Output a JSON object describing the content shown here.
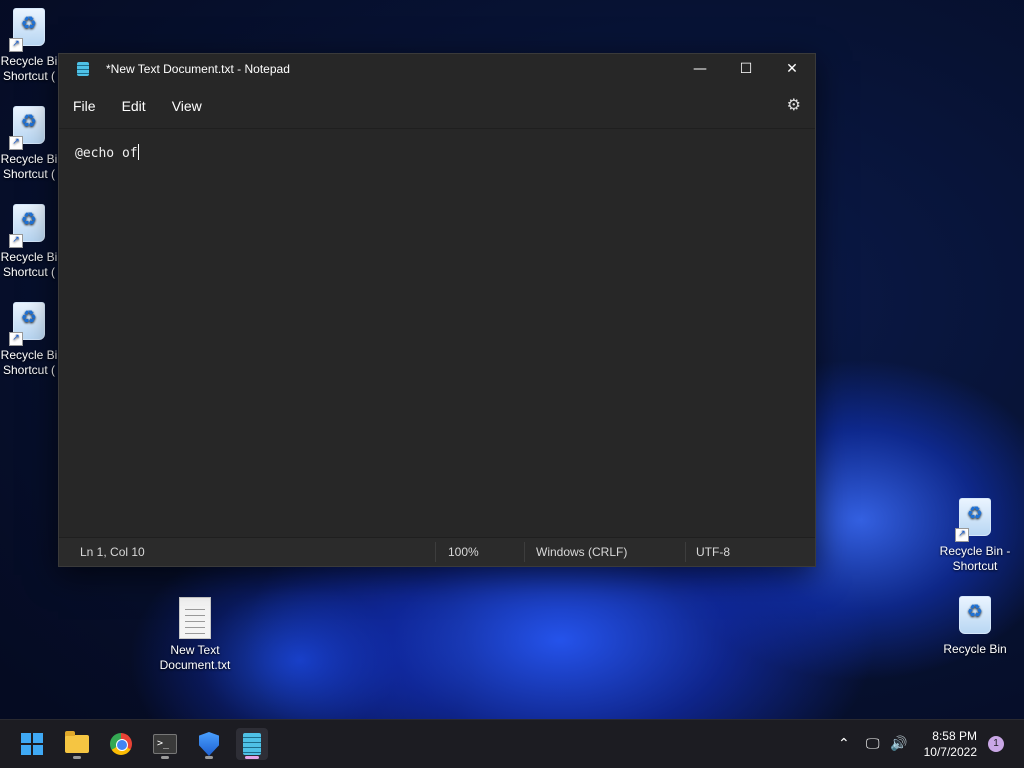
{
  "desktop": {
    "left_icons": [
      {
        "label_line1": "Recycle Bi",
        "label_line2": "Shortcut ("
      },
      {
        "label_line1": "Recycle Bi",
        "label_line2": "Shortcut ("
      },
      {
        "label_line1": "Recycle Bi",
        "label_line2": "Shortcut ("
      },
      {
        "label_line1": "Recycle Bi",
        "label_line2": "Shortcut ("
      }
    ],
    "right_icons": [
      {
        "label_line1": "Recycle Bin -",
        "label_line2": "Shortcut"
      },
      {
        "label_line1": "Recycle Bin",
        "label_line2": ""
      }
    ],
    "file_icon": {
      "label_line1": "New Text",
      "label_line2": "Document.txt"
    }
  },
  "notepad": {
    "title": "*New Text Document.txt - Notepad",
    "menu": [
      "File",
      "Edit",
      "View"
    ],
    "content": "@echo of",
    "status": {
      "position": "Ln 1, Col 10",
      "zoom": "100%",
      "line_ending": "Windows (CRLF)",
      "encoding": "UTF-8"
    }
  },
  "taskbar": {
    "apps": [
      "start-icon",
      "file-explorer-icon",
      "chrome-icon",
      "terminal-icon",
      "defender-icon",
      "notepad-icon"
    ],
    "time": "8:58 PM",
    "date": "10/7/2022",
    "notification_count": "1"
  }
}
